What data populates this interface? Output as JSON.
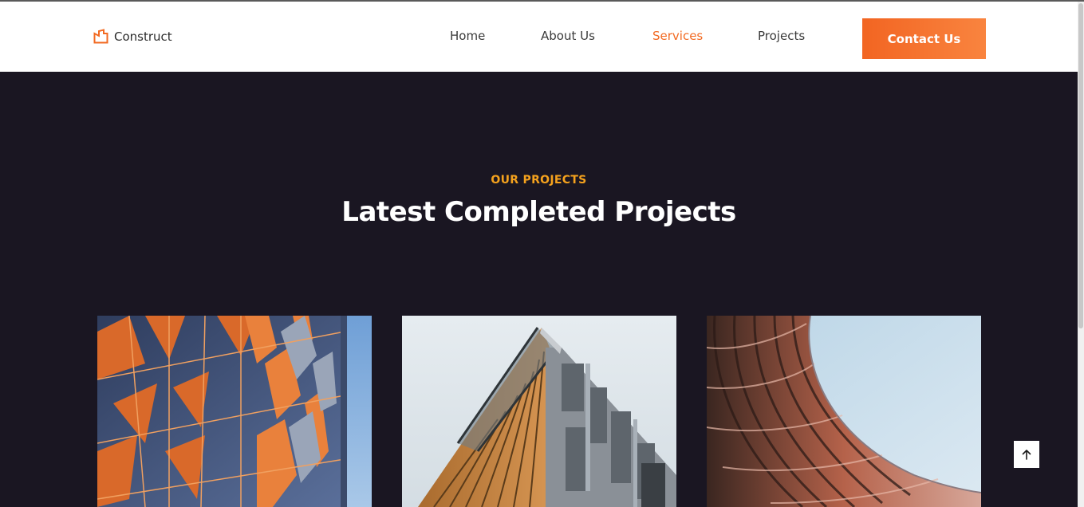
{
  "header": {
    "logo_text": "Construct",
    "logo_icon": "building-icon",
    "nav": [
      {
        "label": "Home",
        "active": false
      },
      {
        "label": "About Us",
        "active": false
      },
      {
        "label": "Services",
        "active": true
      },
      {
        "label": "Projects",
        "active": false
      }
    ],
    "contact_label": "Contact Us"
  },
  "section": {
    "eyebrow": "OUR PROJECTS",
    "title": "Latest Completed Projects"
  },
  "projects": [
    {
      "image": "orange-glass-facade-photo"
    },
    {
      "image": "angled-building-facade-photo"
    },
    {
      "image": "woven-metal-facade-photo"
    }
  ],
  "back_to_top_icon": "arrow-up-icon",
  "colors": {
    "accent": "#f26a22",
    "eyebrow": "#f5a21d",
    "section_bg": "#1a1622",
    "header_bg": "#ffffff"
  }
}
